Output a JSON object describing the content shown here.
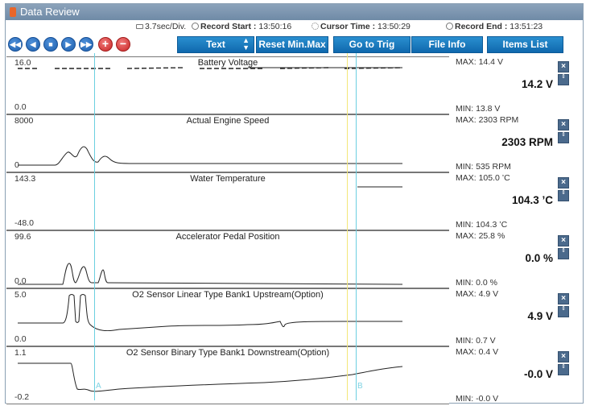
{
  "window": {
    "title": "Data Review"
  },
  "info": {
    "time_div": "3.7sec/Div.",
    "record_start_label": "Record Start :",
    "record_start": "13:50:16",
    "cursor_time_label": "Cursor Time :",
    "cursor_time": "13:50:29",
    "record_end_label": "Record End :",
    "record_end": "13:51:23"
  },
  "toolbar": {
    "nav": [
      {
        "icon": "skip-back-icon",
        "glyph": "◀◀"
      },
      {
        "icon": "step-back-icon",
        "glyph": "◀"
      },
      {
        "icon": "stop-icon",
        "glyph": "■"
      },
      {
        "icon": "play-icon",
        "glyph": "▶"
      },
      {
        "icon": "skip-forward-icon",
        "glyph": "▶▶"
      },
      {
        "icon": "zoom-in-icon",
        "glyph": "+"
      },
      {
        "icon": "zoom-out-icon",
        "glyph": "−"
      }
    ],
    "text_select": "Text",
    "reset_label": "Reset Min.Max",
    "goto_label": "Go to Trig",
    "fileinfo_label": "File Info",
    "items_label": "Items List"
  },
  "cursors": {
    "a_label": "A",
    "b_label": "B"
  },
  "panels": [
    {
      "title": "Battery Voltage",
      "axis_max": "16.0",
      "axis_min": "0.0",
      "side_max": "MAX:  14.4 V",
      "current": "14.2 V",
      "side_min": "MIN:  13.8 V"
    },
    {
      "title": "Actual Engine Speed",
      "axis_max": "8000",
      "axis_min": "0",
      "side_max": "MAX:  2303 RPM",
      "current": "2303 RPM",
      "side_min": "MIN:  535 RPM"
    },
    {
      "title": "Water Temperature",
      "axis_max": "143.3",
      "axis_min": "-48.0",
      "side_max": "MAX: 105.0 ’C",
      "current": "104.3 ’C",
      "side_min": "MIN: 104.3 ’C"
    },
    {
      "title": "Accelerator Pedal Position",
      "axis_max": "99.6",
      "axis_min": "0.0",
      "side_max": "MAX:  25.8 %",
      "current": "0.0 %",
      "side_min": "MIN:  0.0 %"
    },
    {
      "title": "O2 Sensor Linear Type Bank1 Upstream(Option)",
      "axis_max": "5.0",
      "axis_min": "0.0",
      "side_max": "MAX:   4.9 V",
      "current": "4.9 V",
      "side_min": "MIN:  0.7 V"
    },
    {
      "title": "O2 Sensor Binary Type Bank1 Downstream(Option)",
      "axis_max": "1.1",
      "axis_min": "-0.2",
      "side_max": "MAX:   0.4 V",
      "current": "-0.0 V",
      "side_min": "MIN:  -0.0 V"
    }
  ],
  "buttons": {
    "close": "×",
    "adjust": "⇕"
  }
}
